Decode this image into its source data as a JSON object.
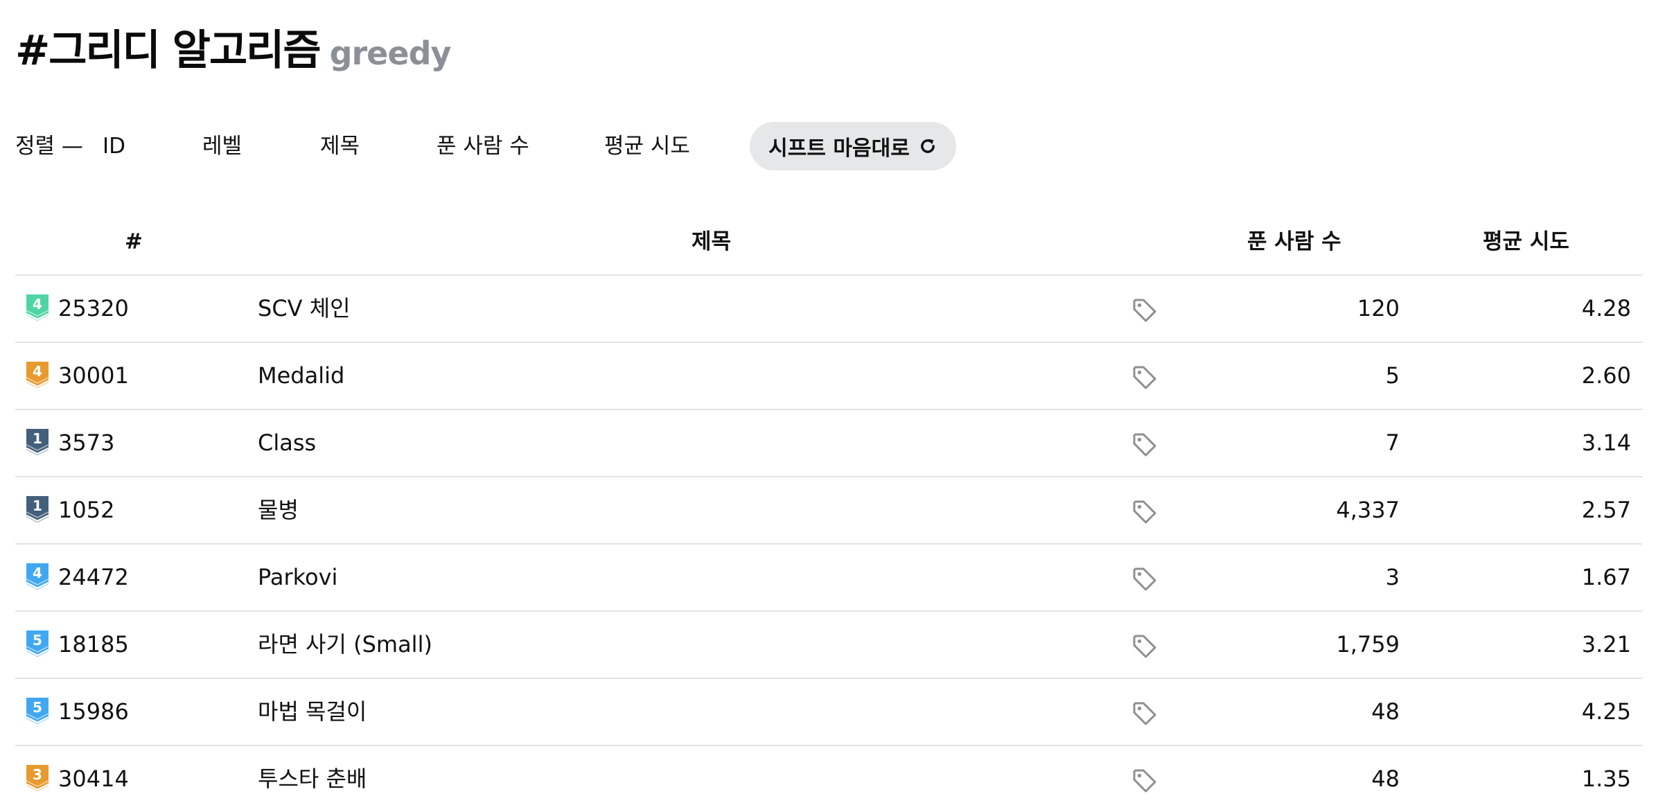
{
  "header": {
    "title": "#그리디 알고리즘",
    "subtitle": "greedy"
  },
  "sort": {
    "label": "정렬 —",
    "options": [
      "ID",
      "레벨",
      "제목",
      "푼 사람 수",
      "평균 시도"
    ],
    "shuffle_label": "시프트 마음대로",
    "shuffle_icon": "refresh-icon"
  },
  "table": {
    "headers": {
      "id": "#",
      "title": "제목",
      "solved": "푼 사람 수",
      "avg": "평균 시도"
    },
    "rows": [
      {
        "tier": "4",
        "tier_color": "#4fd5a3",
        "id": "25320",
        "title": "SCV 체인",
        "solved": "120",
        "avg": "4.28"
      },
      {
        "tier": "4",
        "tier_color": "#e89a2e",
        "id": "30001",
        "title": "Medalid",
        "solved": "5",
        "avg": "2.60"
      },
      {
        "tier": "1",
        "tier_color": "#435f7a",
        "id": "3573",
        "title": "Class",
        "solved": "7",
        "avg": "3.14"
      },
      {
        "tier": "1",
        "tier_color": "#435f7a",
        "id": "1052",
        "title": "물병",
        "solved": "4,337",
        "avg": "2.57"
      },
      {
        "tier": "4",
        "tier_color": "#41a8f0",
        "id": "24472",
        "title": "Parkovi",
        "solved": "3",
        "avg": "1.67"
      },
      {
        "tier": "5",
        "tier_color": "#41a8f0",
        "id": "18185",
        "title": "라면 사기 (Small)",
        "solved": "1,759",
        "avg": "3.21"
      },
      {
        "tier": "5",
        "tier_color": "#41a8f0",
        "id": "15986",
        "title": "마법 목걸이",
        "solved": "48",
        "avg": "4.25"
      },
      {
        "tier": "3",
        "tier_color": "#e89a2e",
        "id": "30414",
        "title": "투스타 춘배",
        "solved": "48",
        "avg": "1.35"
      }
    ],
    "tag_icon": "tag-icon"
  }
}
